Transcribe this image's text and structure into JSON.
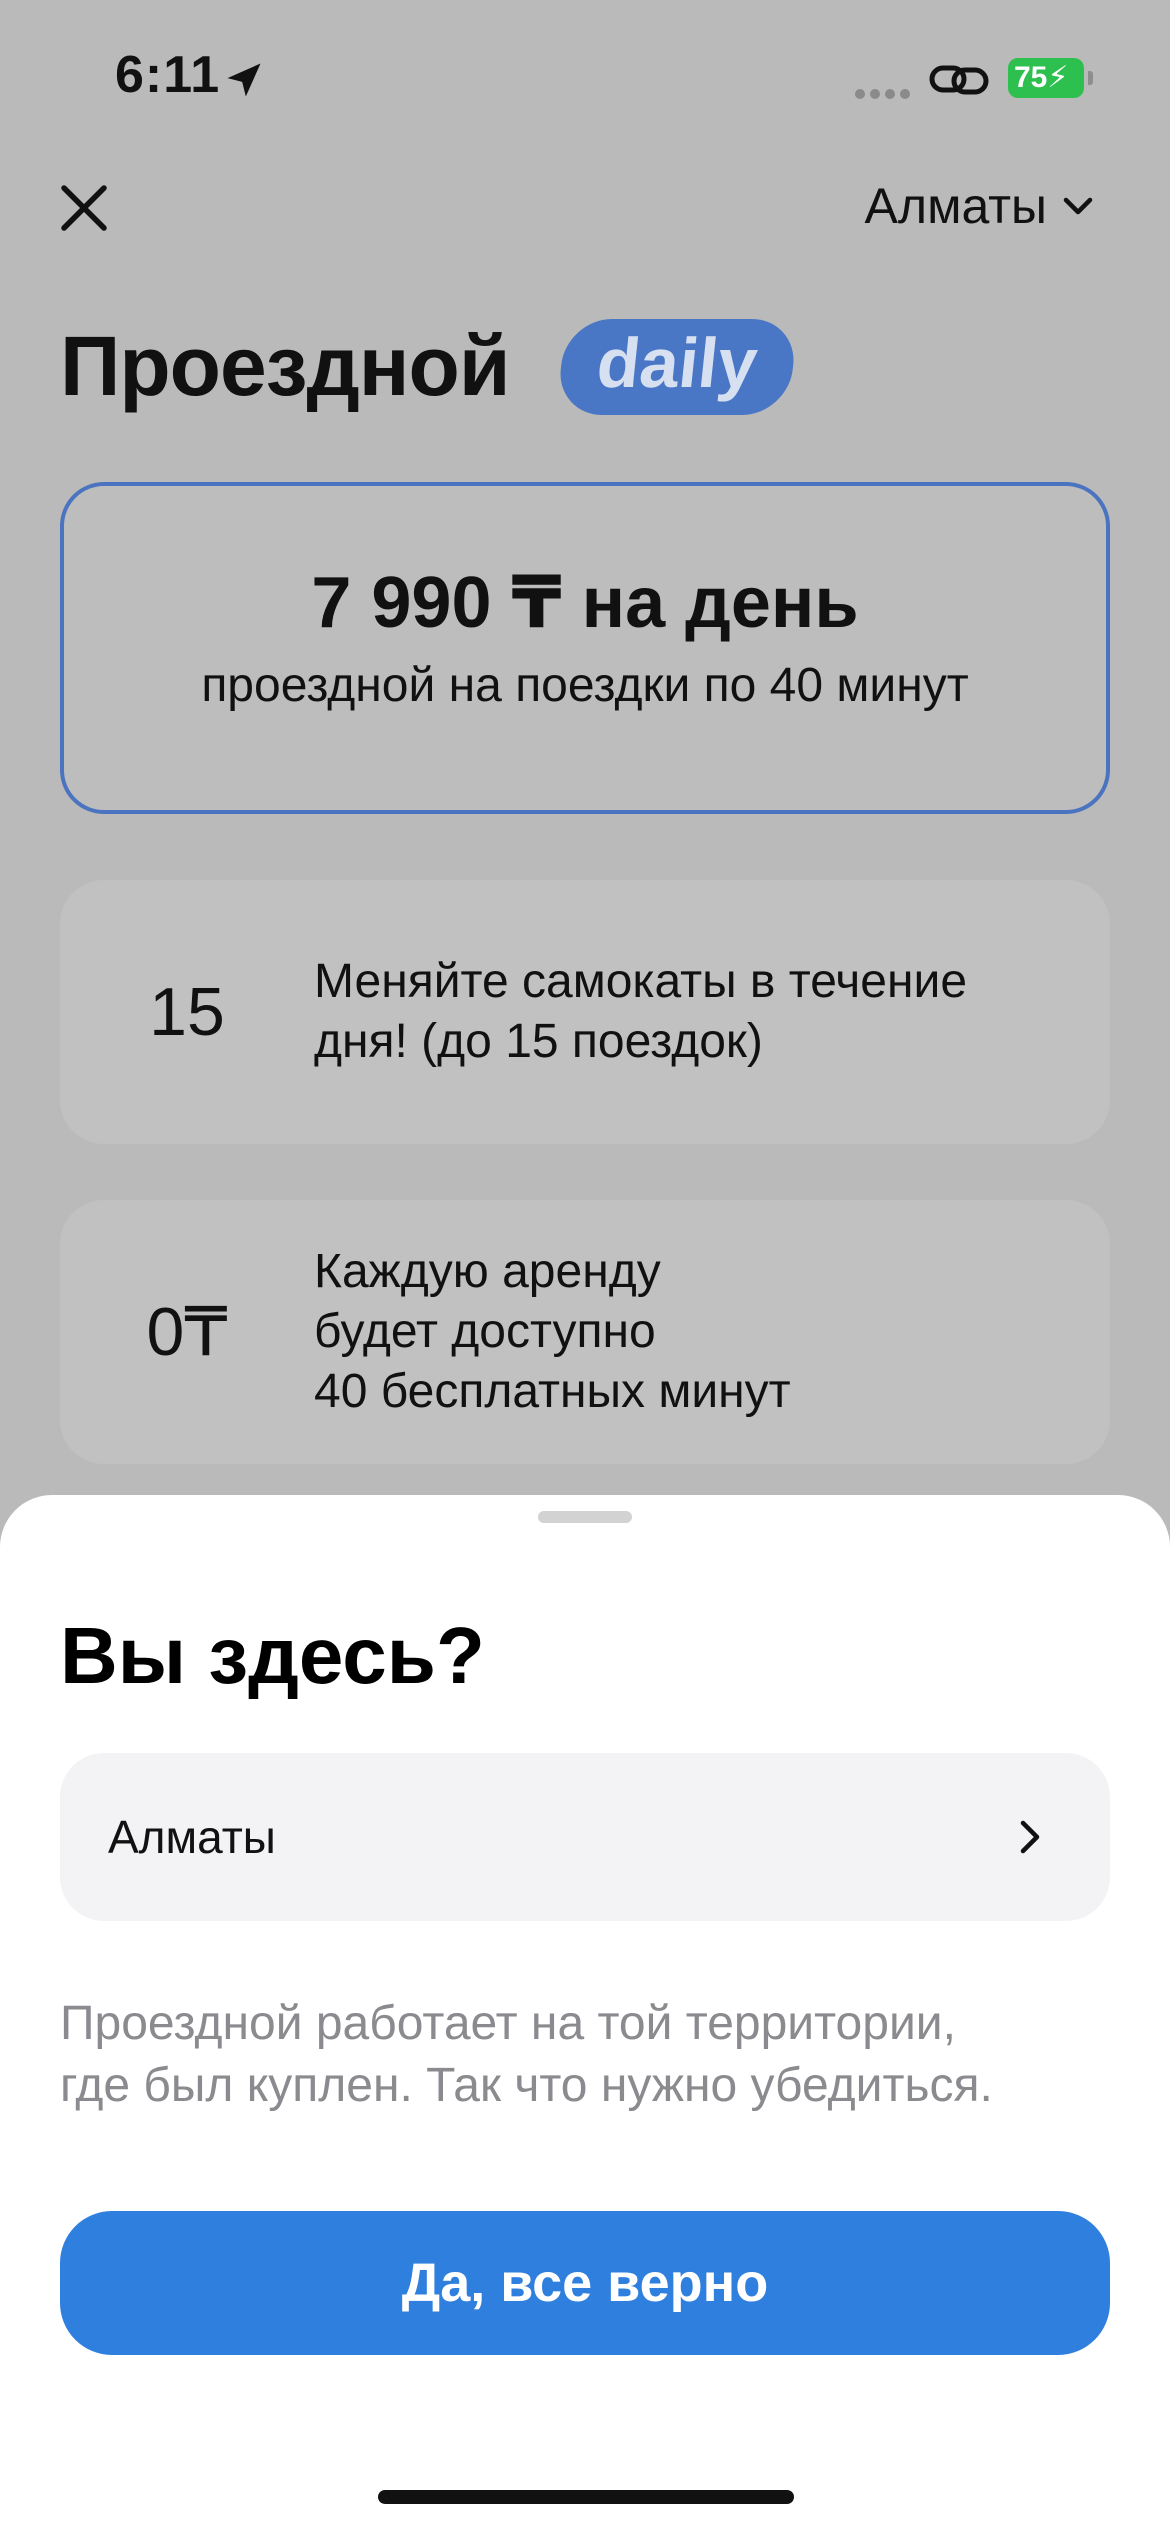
{
  "status_bar": {
    "time": "6:11",
    "battery": "75"
  },
  "header": {
    "city": "Алматы"
  },
  "title": {
    "text": "Проездной",
    "badge": "daily"
  },
  "price_card": {
    "main": "7 990 ₸ на день",
    "sub": "проездной на поездки по 40 минут"
  },
  "features": [
    {
      "value": "15",
      "lines": [
        "Меняйте самокаты в течение",
        "дня! (до 15 поездок)"
      ]
    },
    {
      "value": "0₸",
      "lines": [
        "Каждую аренду",
        "будет доступно",
        "40 бесплатных минут"
      ]
    }
  ],
  "sheet": {
    "title": "Вы здесь?",
    "city": "Алматы",
    "note_lines": [
      "Проездной работает на той территории,",
      "где был куплен. Так что нужно убедиться."
    ],
    "confirm_label": "Да, все верно"
  },
  "colors": {
    "accent": "#2f7fdf",
    "badge": "#4a77c5",
    "battery": "#2ec04f"
  }
}
